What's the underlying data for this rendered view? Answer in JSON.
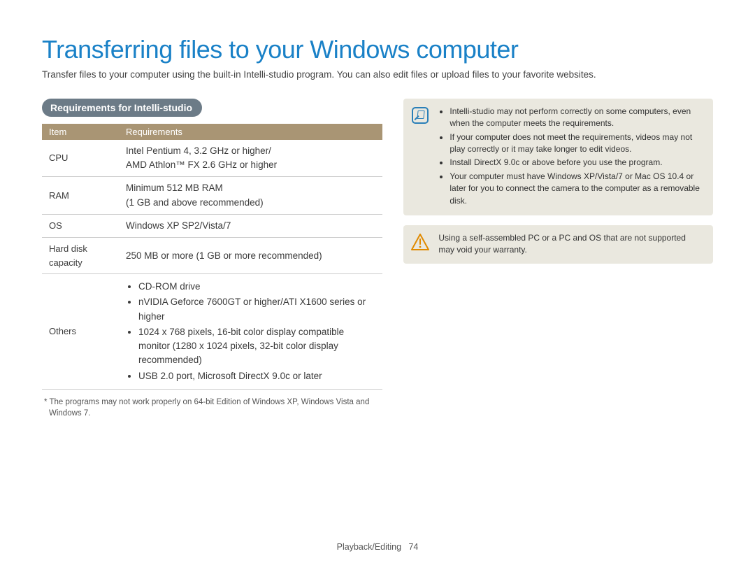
{
  "title": "Transferring files to your Windows computer",
  "intro": "Transfer files to your computer using the built-in Intelli-studio program. You can also edit files or upload files to your favorite websites.",
  "section_heading": "Requirements for Intelli-studio",
  "table": {
    "headers": {
      "item": "Item",
      "req": "Requirements"
    },
    "rows": [
      {
        "item": "CPU",
        "req": "Intel Pentium 4, 3.2 GHz or higher/\nAMD Athlon™ FX 2.6 GHz or higher"
      },
      {
        "item": "RAM",
        "req": "Minimum 512 MB RAM\n(1 GB and above recommended)"
      },
      {
        "item": "OS",
        "req": "Windows XP SP2/Vista/7"
      },
      {
        "item": "Hard disk capacity",
        "req": "250 MB or more (1 GB or more recommended)"
      }
    ],
    "others_row": {
      "item": "Others",
      "bullets": [
        "CD-ROM drive",
        "nVIDIA Geforce 7600GT or higher/ATI X1600 series or higher",
        "1024 x 768 pixels, 16-bit color display compatible monitor (1280 x 1024 pixels, 32-bit color display recommended)",
        "USB 2.0 port, Microsoft DirectX 9.0c or later"
      ]
    }
  },
  "footnote": "* The programs may not work properly on 64-bit Edition of Windows XP, Windows Vista and Windows 7.",
  "note_box": {
    "bullets": [
      "Intelli-studio may not perform correctly on some computers, even when the computer meets the requirements.",
      "If your computer does not meet the requirements, videos may not play correctly or it may take longer to edit videos.",
      "Install DirectX 9.0c or above before you use the program.",
      "Your computer must have Windows XP/Vista/7 or Mac OS 10.4 or later for you to connect the camera to the computer as a removable disk."
    ]
  },
  "warn_box": {
    "text": "Using a self-assembled PC or a PC and OS that are not supported may void your warranty."
  },
  "footer": {
    "section": "Playback/Editing",
    "page": "74"
  }
}
